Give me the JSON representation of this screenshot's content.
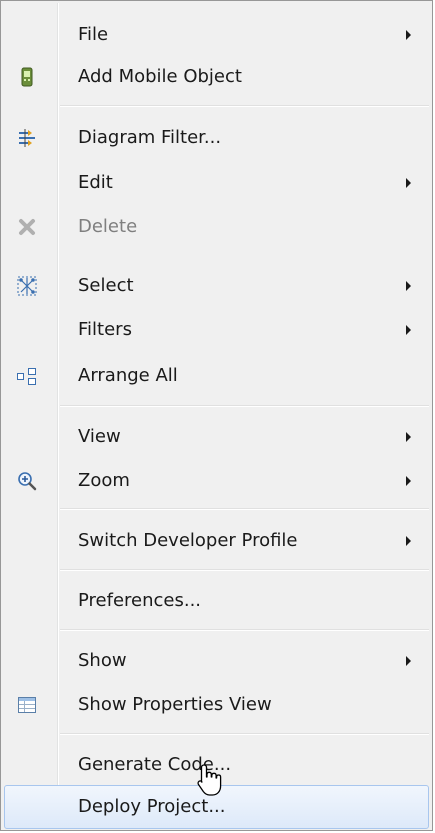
{
  "menu": {
    "items": [
      {
        "label": "File",
        "submenu": true
      },
      {
        "label": "Add Mobile Object",
        "icon": "mobile-object-icon"
      },
      {
        "label": "Diagram Filter...",
        "icon": "diagram-filter-icon"
      },
      {
        "label": "Edit",
        "submenu": true
      },
      {
        "label": "Delete",
        "icon": "delete-icon",
        "disabled": true
      },
      {
        "label": "Select",
        "icon": "select-icon",
        "submenu": true
      },
      {
        "label": "Filters",
        "submenu": true
      },
      {
        "label": "Arrange All",
        "icon": "arrange-all-icon"
      },
      {
        "label": "View",
        "submenu": true
      },
      {
        "label": "Zoom",
        "icon": "zoom-icon",
        "submenu": true
      },
      {
        "label": "Switch Developer Profile",
        "submenu": true
      },
      {
        "label": "Preferences..."
      },
      {
        "label": "Show",
        "submenu": true
      },
      {
        "label": "Show Properties View",
        "icon": "properties-view-icon"
      },
      {
        "label": "Generate Code..."
      },
      {
        "label": "Deploy Project...",
        "highlighted": true
      }
    ]
  },
  "colors": {
    "menu_background": "#f0f0f0",
    "highlight_border": "#a8c6ee",
    "disabled_text": "#7f7f7f"
  }
}
